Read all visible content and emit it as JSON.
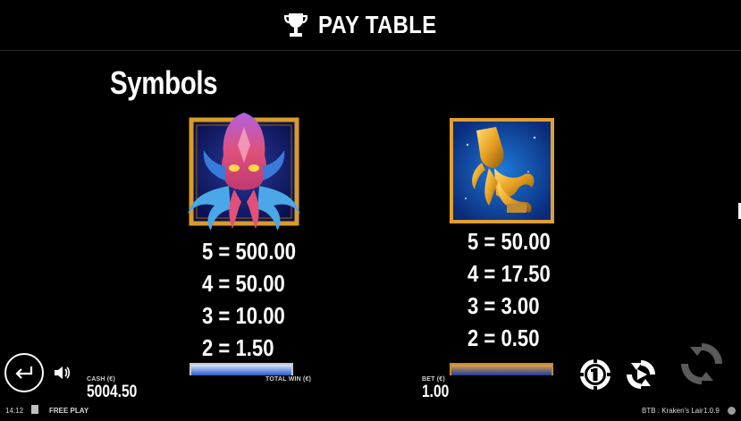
{
  "header": {
    "title": "PAY TABLE",
    "icon": "trophy-icon"
  },
  "section_title": "Symbols",
  "symbols": [
    {
      "name": "kraken",
      "pays": [
        "5 = 500.00",
        "4 = 50.00",
        "3 = 10.00",
        "2 = 1.50"
      ]
    },
    {
      "name": "golden-squid",
      "pays": [
        "5 = 50.00",
        "4 = 17.50",
        "3 = 3.00",
        "2 = 0.50"
      ]
    }
  ],
  "bottom_bar": {
    "cash_label": "CASH (€)",
    "cash_value": "5004.50",
    "total_win_label": "TOTAL WIN (€)",
    "total_win_value": "",
    "bet_label": "BET (€)",
    "bet_value": "1.00"
  },
  "footer": {
    "time": "14:12",
    "mode": "FREE PLAY",
    "game": "BTB : Kraken's Lair",
    "version": "1.0.9"
  },
  "colors": {
    "background": "#000000",
    "text": "#ffffff",
    "frame_gold": "#d99b2a"
  }
}
